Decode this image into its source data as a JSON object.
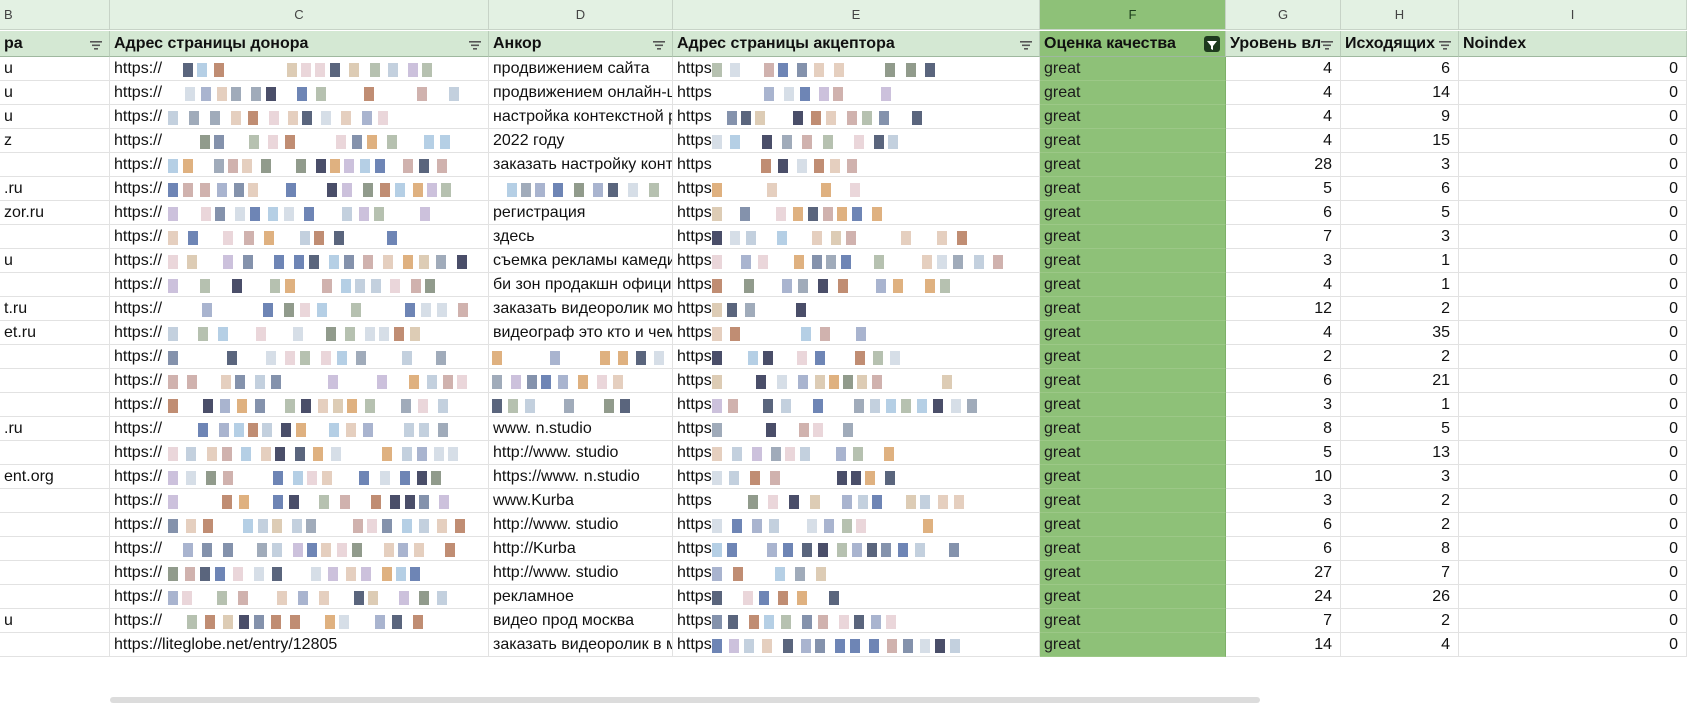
{
  "columns": {
    "letters": [
      "B",
      "C",
      "D",
      "E",
      "F",
      "G",
      "H",
      "I"
    ],
    "selected_letter": "F",
    "headers": [
      "ра",
      "Адрес страницы донора",
      "Анкор",
      "Адрес страницы акцептора",
      "Оценка качества",
      "Уровень вл",
      "Исходящих",
      "Noindex"
    ]
  },
  "rows": [
    {
      "b": "u",
      "c": "https://",
      "d": "продвижением сайта",
      "e": "https",
      "f": "great",
      "g": "4",
      "h": "6",
      "i": "0"
    },
    {
      "b": "u",
      "c": "https://",
      "d": "продвижением онлайн-ш",
      "e": "https",
      "f": "great",
      "g": "4",
      "h": "14",
      "i": "0"
    },
    {
      "b": "u",
      "c": "https://",
      "d": "настройка контекстной р",
      "e": "https",
      "f": "great",
      "g": "4",
      "h": "9",
      "i": "0"
    },
    {
      "b": "z",
      "c": "https://",
      "d": "2022 году",
      "e": "https",
      "f": "great",
      "g": "4",
      "h": "15",
      "i": "0"
    },
    {
      "b": "",
      "c": "https://",
      "d": "заказать настройку конте",
      "e": "https",
      "f": "great",
      "g": "28",
      "h": "3",
      "i": "0"
    },
    {
      "b": ".ru",
      "c": "https://",
      "d": "",
      "e": "https",
      "f": "great",
      "g": "5",
      "h": "6",
      "i": "0"
    },
    {
      "b": "zor.ru",
      "c": "https://",
      "d": "регистрация",
      "e": "https",
      "f": "great",
      "g": "6",
      "h": "5",
      "i": "0"
    },
    {
      "b": "",
      "c": "https://",
      "d": "здесь",
      "e": "https",
      "f": "great",
      "g": "7",
      "h": "3",
      "i": "0"
    },
    {
      "b": "u",
      "c": "https://",
      "d": "съемка рекламы камеди",
      "e": "https",
      "f": "great",
      "g": "3",
      "h": "1",
      "i": "0"
    },
    {
      "b": "",
      "c": "https://",
      "d": "би зон продакшн официа",
      "e": "https",
      "f": "great",
      "g": "4",
      "h": "1",
      "i": "0"
    },
    {
      "b": "t.ru",
      "c": "https://",
      "d": "заказать видеоролик мос",
      "e": "https",
      "f": "great",
      "g": "12",
      "h": "2",
      "i": "0"
    },
    {
      "b": "et.ru",
      "c": "https://",
      "d": "видеограф это кто и чем",
      "e": "https",
      "f": "great",
      "g": "4",
      "h": "35",
      "i": "0"
    },
    {
      "b": "",
      "c": "https://",
      "d": "",
      "e": "https",
      "f": "great",
      "g": "2",
      "h": "2",
      "i": "0"
    },
    {
      "b": "",
      "c": "https://",
      "d": "",
      "e": "https",
      "f": "great",
      "g": "6",
      "h": "21",
      "i": "0"
    },
    {
      "b": "",
      "c": "https://",
      "d": "",
      "e": "https",
      "f": "great",
      "g": "3",
      "h": "1",
      "i": "0"
    },
    {
      "b": ".ru",
      "c": "https://",
      "d": "www.           n.studio",
      "e": "https",
      "f": "great",
      "g": "8",
      "h": "5",
      "i": "0"
    },
    {
      "b": "",
      "c": "https://",
      "d": "http://www.           studio",
      "e": "https",
      "f": "great",
      "g": "5",
      "h": "13",
      "i": "0"
    },
    {
      "b": "ent.org",
      "c": "https://",
      "d": "https://www.         n.studio",
      "e": "https",
      "f": "great",
      "g": "10",
      "h": "3",
      "i": "0"
    },
    {
      "b": "",
      "c": "https://",
      "d": "www.Kurba",
      "e": "https",
      "f": "great",
      "g": "3",
      "h": "2",
      "i": "0"
    },
    {
      "b": "",
      "c": "https://",
      "d": "http://www.             studio",
      "e": "https",
      "f": "great",
      "g": "6",
      "h": "2",
      "i": "0"
    },
    {
      "b": "",
      "c": "https://",
      "d": "http://Kurba",
      "e": "https",
      "f": "great",
      "g": "6",
      "h": "8",
      "i": "0"
    },
    {
      "b": "",
      "c": "https://",
      "d": "http://www.           studio",
      "e": "https",
      "f": "great",
      "g": "27",
      "h": "7",
      "i": "0"
    },
    {
      "b": "",
      "c": "https://",
      "d": "рекламное",
      "e": "https",
      "f": "great",
      "g": "24",
      "h": "26",
      "i": "0"
    },
    {
      "b": "u",
      "c": "https://",
      "d": "видео прод         москва",
      "e": "https",
      "f": "great",
      "g": "7",
      "h": "2",
      "i": "0"
    },
    {
      "b": "",
      "c": "https://liteglobe.net/entry/12805",
      "d": "заказать видеоролик в м",
      "e": "https",
      "f": "great",
      "g": "14",
      "h": "4",
      "i": "0"
    }
  ],
  "colors": {
    "header_bg": "#d4e8d3",
    "column_letter_bg": "#e3f1e3",
    "quality_column_bg": "#8ec178",
    "filter_active_bg": "#1e3a1e"
  },
  "icons": {
    "header_filter": "filter-lines-icon",
    "active_filter": "funnel-filter-icon"
  }
}
